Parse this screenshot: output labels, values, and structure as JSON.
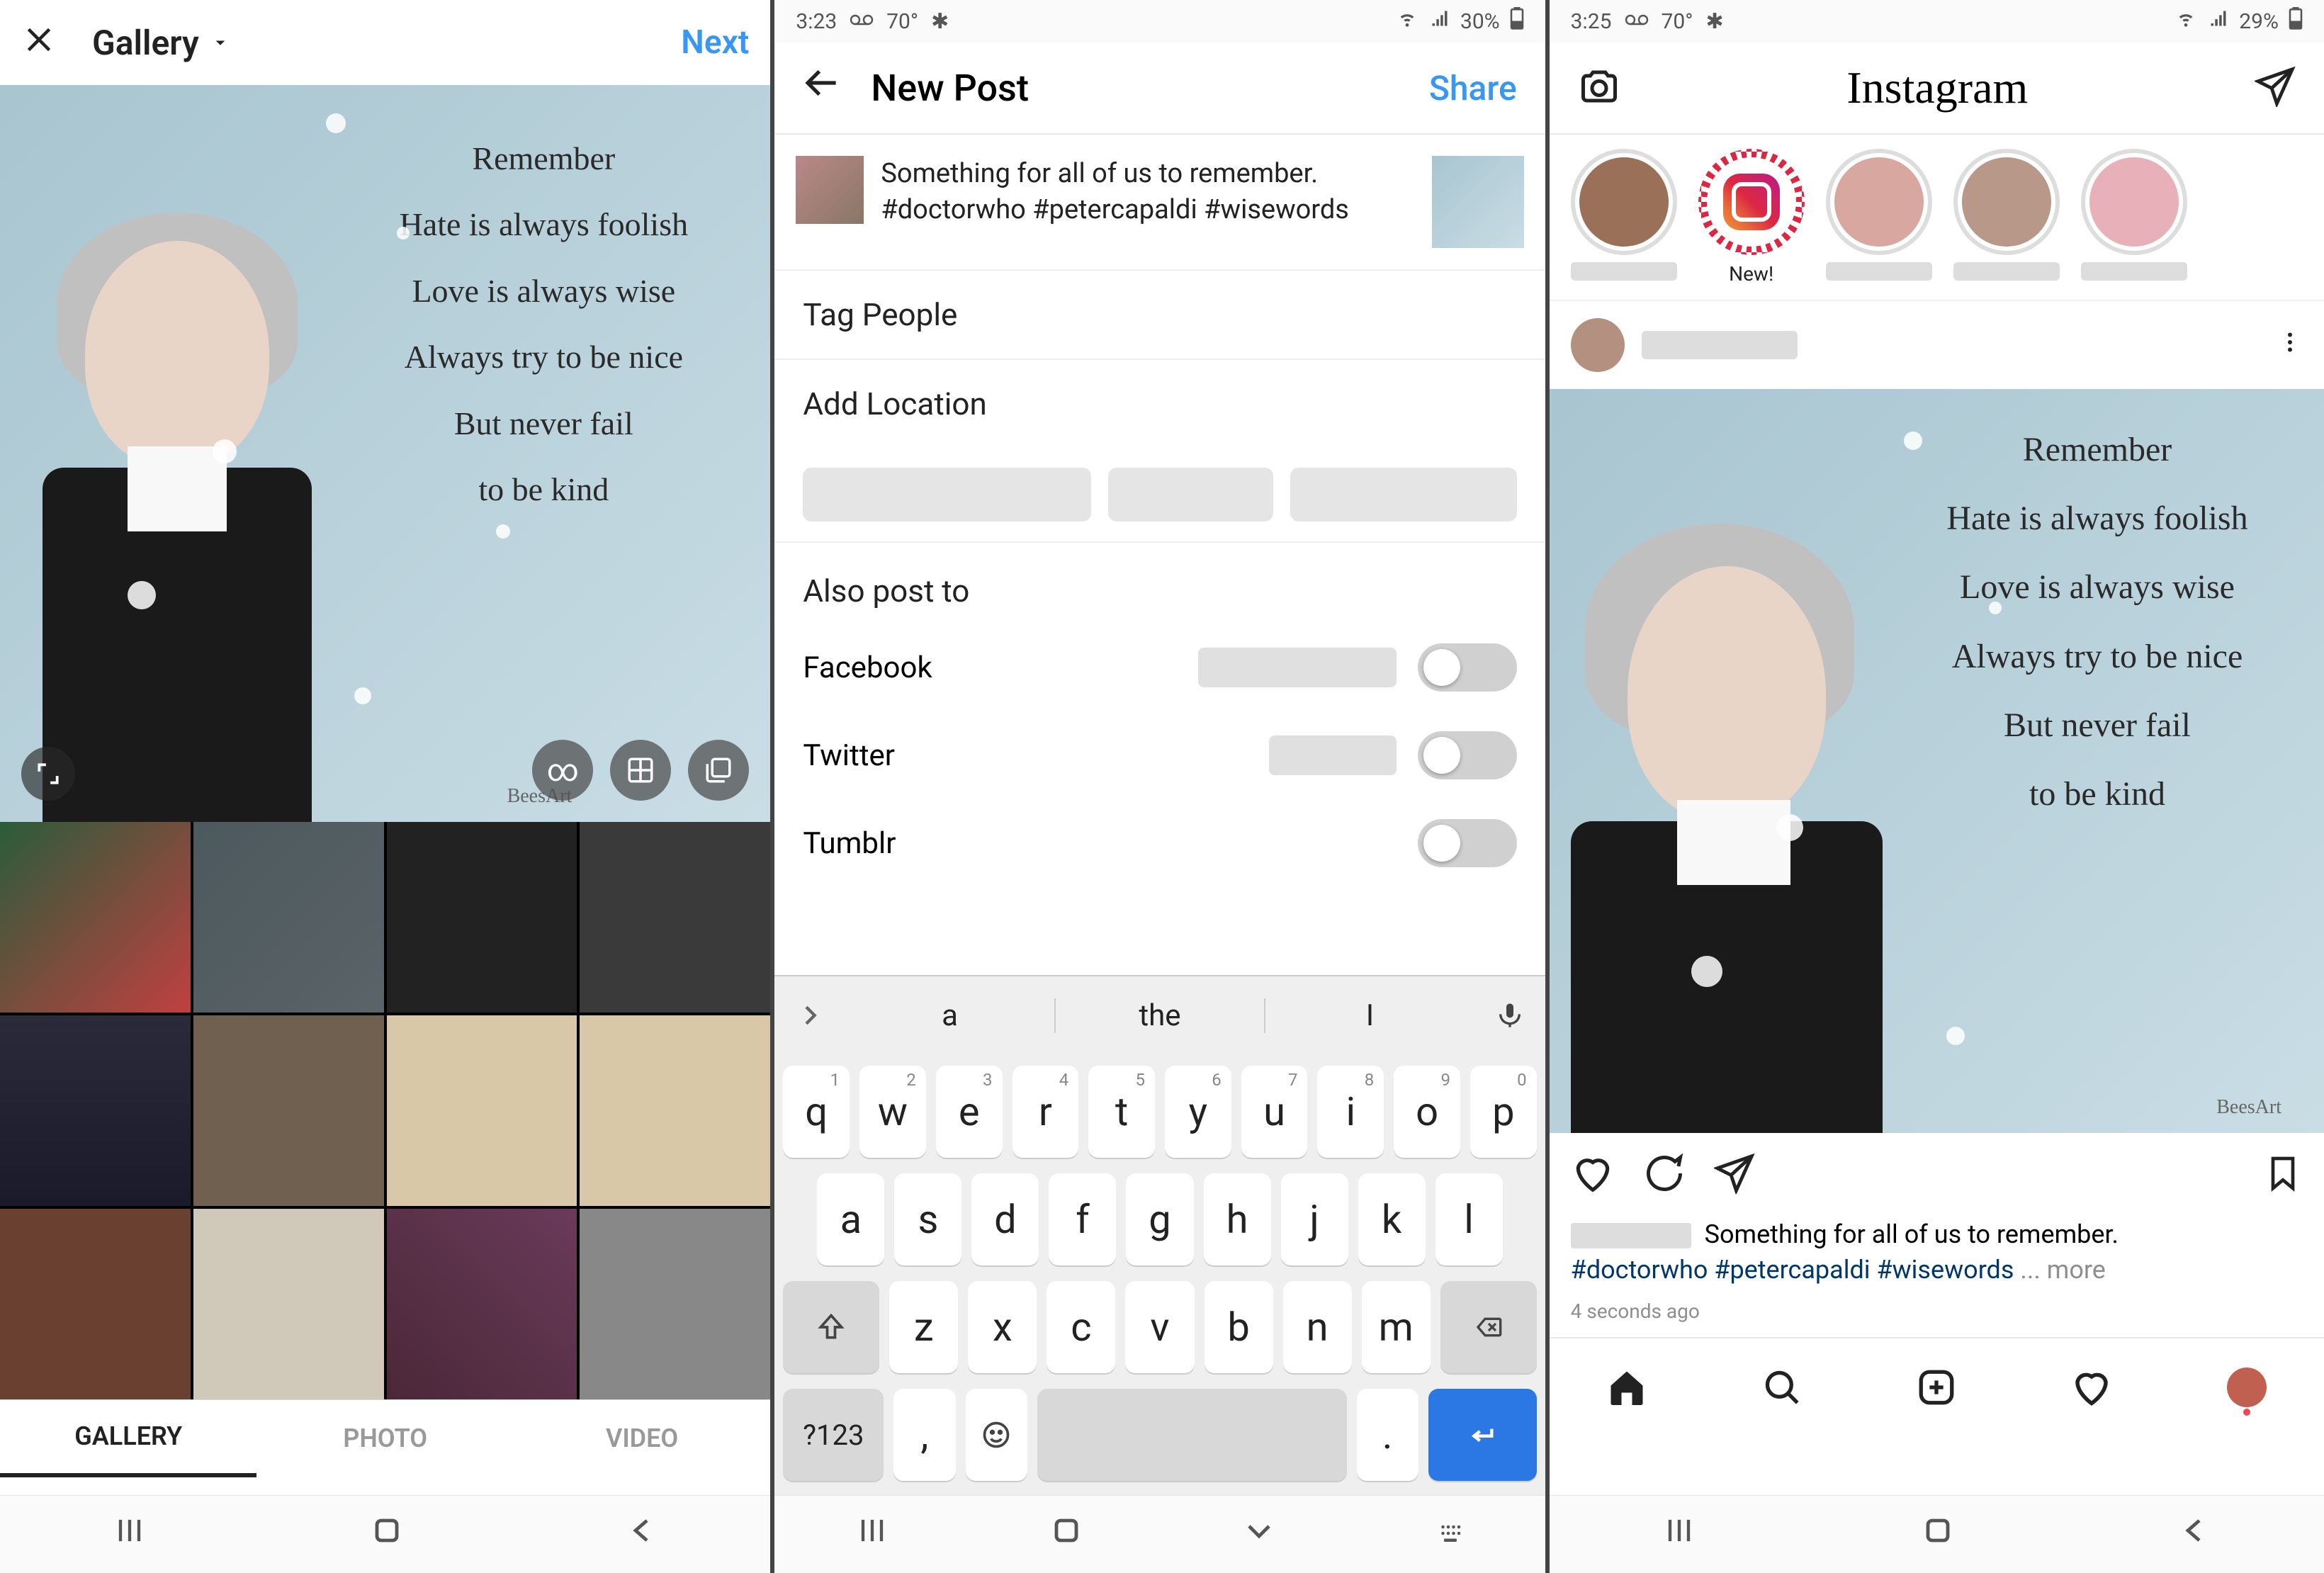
{
  "screen1": {
    "header": {
      "gallery": "Gallery",
      "next": "Next"
    },
    "quote": {
      "l1": "Remember",
      "l2": "Hate is always foolish",
      "l3": "Love is always wise",
      "l4": "Always try to be nice",
      "l5": "But never fail",
      "l6": "to be kind"
    },
    "watermark": "BeesArt",
    "infinity": "∞",
    "tabs": {
      "gallery": "GALLERY",
      "photo": "PHOTO",
      "video": "VIDEO"
    }
  },
  "screen2": {
    "status": {
      "time": "3:23",
      "temp": "70°",
      "battery": "30%"
    },
    "header": {
      "title": "New Post",
      "share": "Share"
    },
    "caption": "Something for all of us to remember. #doctorwho #petercapaldi #wisewords",
    "tag_people": "Tag People",
    "add_location": "Add Location",
    "also_post": "Also post to",
    "networks": {
      "facebook": "Facebook",
      "twitter": "Twitter",
      "tumblr": "Tumblr"
    },
    "suggestions": {
      "s1": "a",
      "s2": "the",
      "s3": "I"
    },
    "keys": {
      "row1": [
        "q",
        "w",
        "e",
        "r",
        "t",
        "y",
        "u",
        "i",
        "o",
        "p"
      ],
      "row1nums": [
        "1",
        "2",
        "3",
        "4",
        "5",
        "6",
        "7",
        "8",
        "9",
        "0"
      ],
      "row2": [
        "a",
        "s",
        "d",
        "f",
        "g",
        "h",
        "j",
        "k",
        "l"
      ],
      "row3": [
        "z",
        "x",
        "c",
        "v",
        "b",
        "n",
        "m"
      ],
      "sym": "?123",
      "comma": ",",
      "period": "."
    }
  },
  "screen3": {
    "status": {
      "time": "3:25",
      "temp": "70°",
      "battery": "29%"
    },
    "logo": "Instagram",
    "story_new": "New!",
    "caption_text": "Something for all of us to remember.",
    "hashtags": "#doctorwho #petercapaldi #wisewords",
    "more": "... more",
    "timestamp": "4 seconds ago",
    "quote": {
      "l1": "Remember",
      "l2": "Hate is always foolish",
      "l3": "Love is always wise",
      "l4": "Always try to be nice",
      "l5": "But never fail",
      "l6": "to be kind"
    },
    "watermark": "BeesArt"
  }
}
